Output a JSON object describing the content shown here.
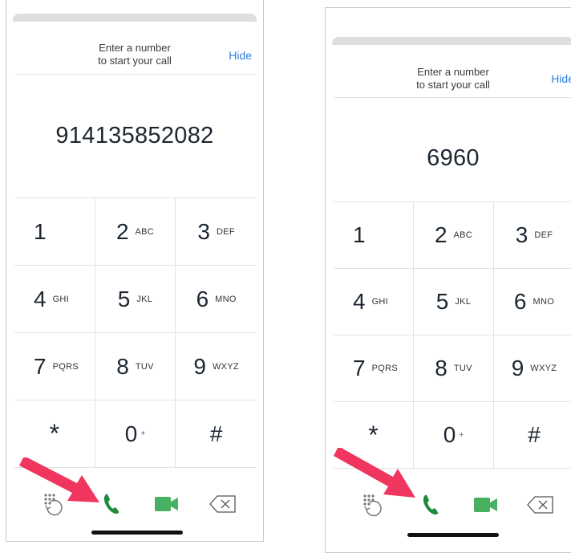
{
  "colors": {
    "link": "#2d7fe0",
    "call_green": "#1f8a3a",
    "video_green": "#47b061",
    "arrow": "#f0365f"
  },
  "screens": [
    {
      "prompt_line1": "Enter a number",
      "prompt_line2": "to start your call",
      "hide_label": "Hide",
      "number": "914135852082"
    },
    {
      "prompt_line1": "Enter a number",
      "prompt_line2": "to start your call",
      "hide_label": "Hide",
      "number": "6960"
    }
  ],
  "keypad": [
    {
      "digit": "1",
      "letters": ""
    },
    {
      "digit": "2",
      "letters": "ABC"
    },
    {
      "digit": "3",
      "letters": "DEF"
    },
    {
      "digit": "4",
      "letters": "GHI"
    },
    {
      "digit": "5",
      "letters": "JKL"
    },
    {
      "digit": "6",
      "letters": "MNO"
    },
    {
      "digit": "7",
      "letters": "PQRS"
    },
    {
      "digit": "8",
      "letters": "TUV"
    },
    {
      "digit": "9",
      "letters": "WXYZ"
    },
    {
      "digit": "*",
      "letters": ""
    },
    {
      "digit": "0",
      "letters": "+"
    },
    {
      "digit": "#",
      "letters": ""
    }
  ],
  "icons": {
    "recent": "recent-calls-icon",
    "call": "phone-icon",
    "video": "video-camera-icon",
    "backspace": "backspace-icon",
    "annotation": "pointer-arrow-icon"
  }
}
